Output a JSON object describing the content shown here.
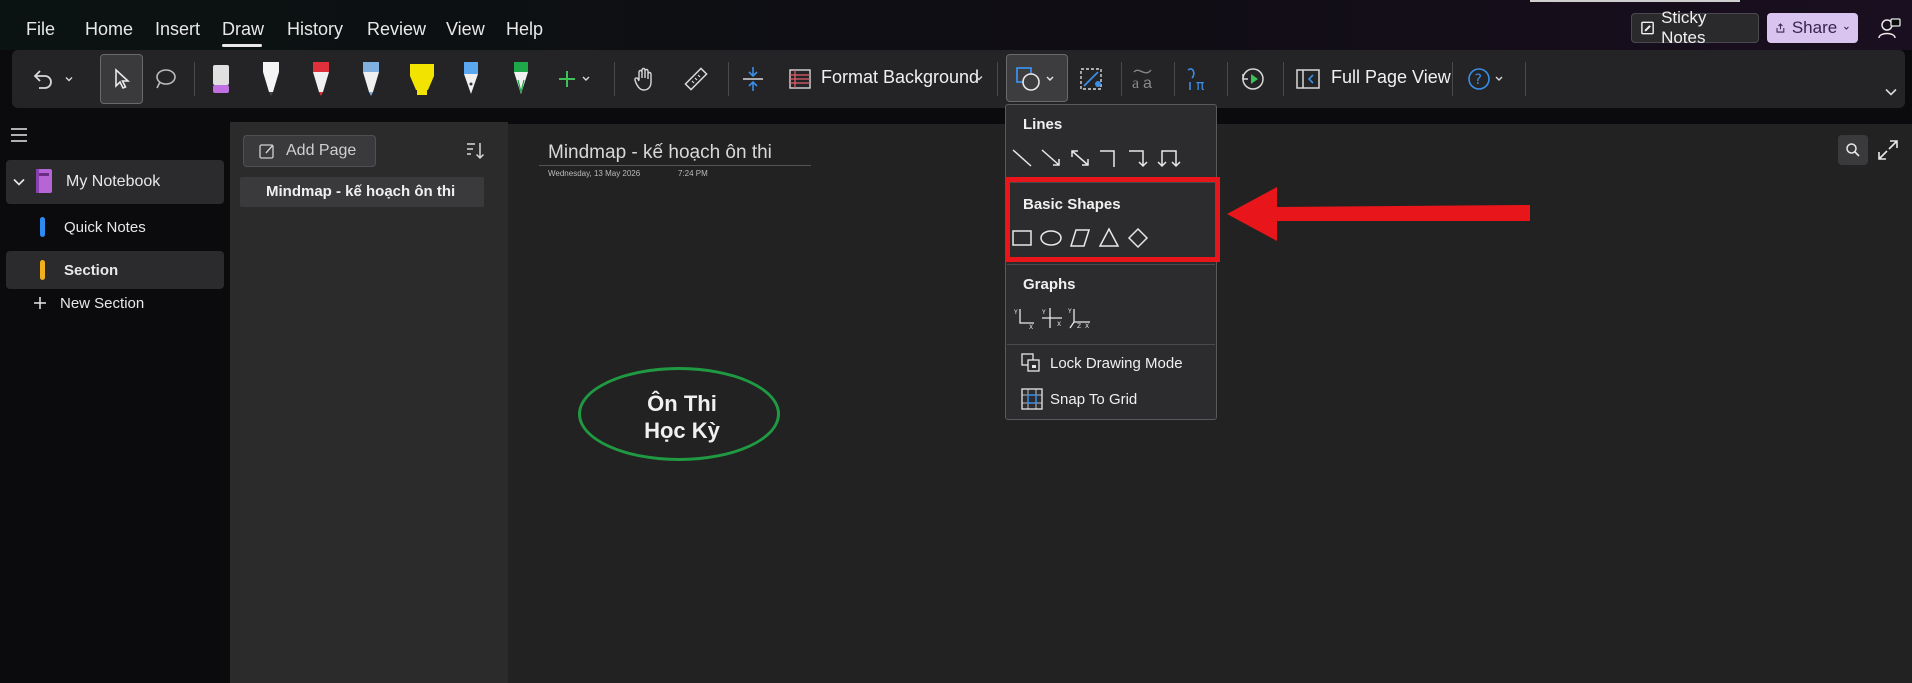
{
  "menubar": {
    "items": [
      "File",
      "Home",
      "Insert",
      "Draw",
      "History",
      "Review",
      "View",
      "Help"
    ],
    "active": "Draw",
    "sticky_notes_label": "Sticky Notes",
    "share_label": "Share"
  },
  "ribbon": {
    "format_background_label": "Format Background",
    "full_page_view_label": "Full Page View",
    "pen_colors": [
      "#c070e0",
      "#f5f5f5",
      "#e0303a",
      "#7fb0e0",
      "#f2e400",
      "#5aa8f0",
      "#1fa84a"
    ],
    "accent_color": "#3a8ee6"
  },
  "nav": {
    "notebook_label": "My Notebook",
    "notebook_color": "#b565d6",
    "quick_notes_label": "Quick Notes",
    "quick_notes_color": "#2e8bf0",
    "section_label": "Section",
    "section_color": "#f0b11c",
    "new_section_label": "New Section"
  },
  "pagelist": {
    "add_page_label": "Add Page",
    "pages": [
      "Mindmap - kế hoạch ôn thi"
    ]
  },
  "page": {
    "title": "Mindmap - kế hoạch ôn thi",
    "date": "Wednesday, 13 May 2026",
    "time": "7:24 PM",
    "node_line1": "Ôn Thi",
    "node_line2": "Học Kỳ",
    "node_color": "#1f9a42"
  },
  "shapes_menu": {
    "lines_heading": "Lines",
    "basic_shapes_heading": "Basic Shapes",
    "graphs_heading": "Graphs",
    "lock_drawing_mode_label": "Lock Drawing Mode",
    "snap_to_grid_label": "Snap To Grid",
    "highlight_color": "#e8161b"
  }
}
